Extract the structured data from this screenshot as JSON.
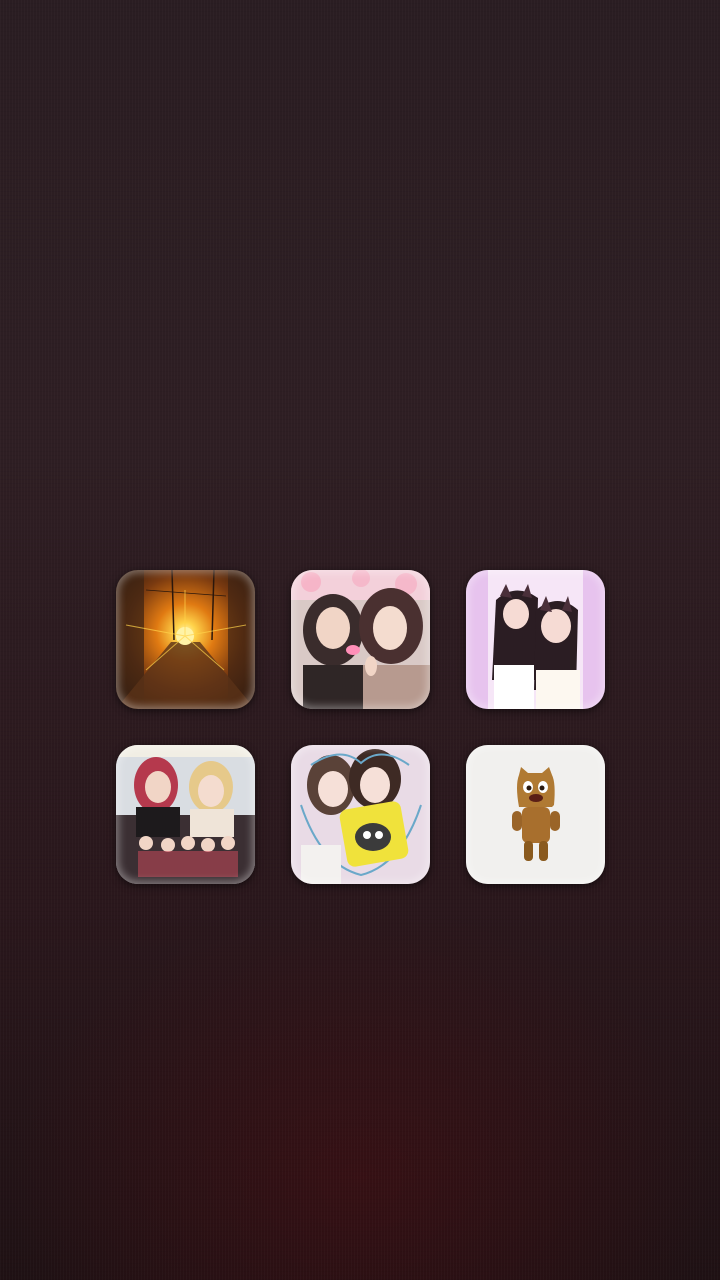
{
  "screen": {
    "background_top": "#2a1d22",
    "background_bottom": "#1f1114",
    "accent_glow": "#46101a"
  },
  "thumbnails": [
    {
      "name": "sunset-street-photo",
      "colors": [
        "#6b3a14",
        "#e07a12",
        "#ffd34a"
      ]
    },
    {
      "name": "two-girls-selfie-photo",
      "colors": [
        "#f3d0da",
        "#b79a8f",
        "#3a2c2c"
      ]
    },
    {
      "name": "cat-filter-selfie-photo",
      "colors": [
        "#e7c3ee",
        "#f6e6f7",
        "#2b1d23"
      ]
    },
    {
      "name": "group-photo-with-stage",
      "colors": [
        "#d9dde2",
        "#3b2f33",
        "#c7495a"
      ]
    },
    {
      "name": "decorated-purikura-photo",
      "colors": [
        "#e9dbe6",
        "#f0e23b",
        "#6aa8c9"
      ]
    },
    {
      "name": "brown-cartoon-character-photo",
      "colors": [
        "#f1f0ee",
        "#b07a33",
        "#8a5a1e"
      ]
    }
  ]
}
